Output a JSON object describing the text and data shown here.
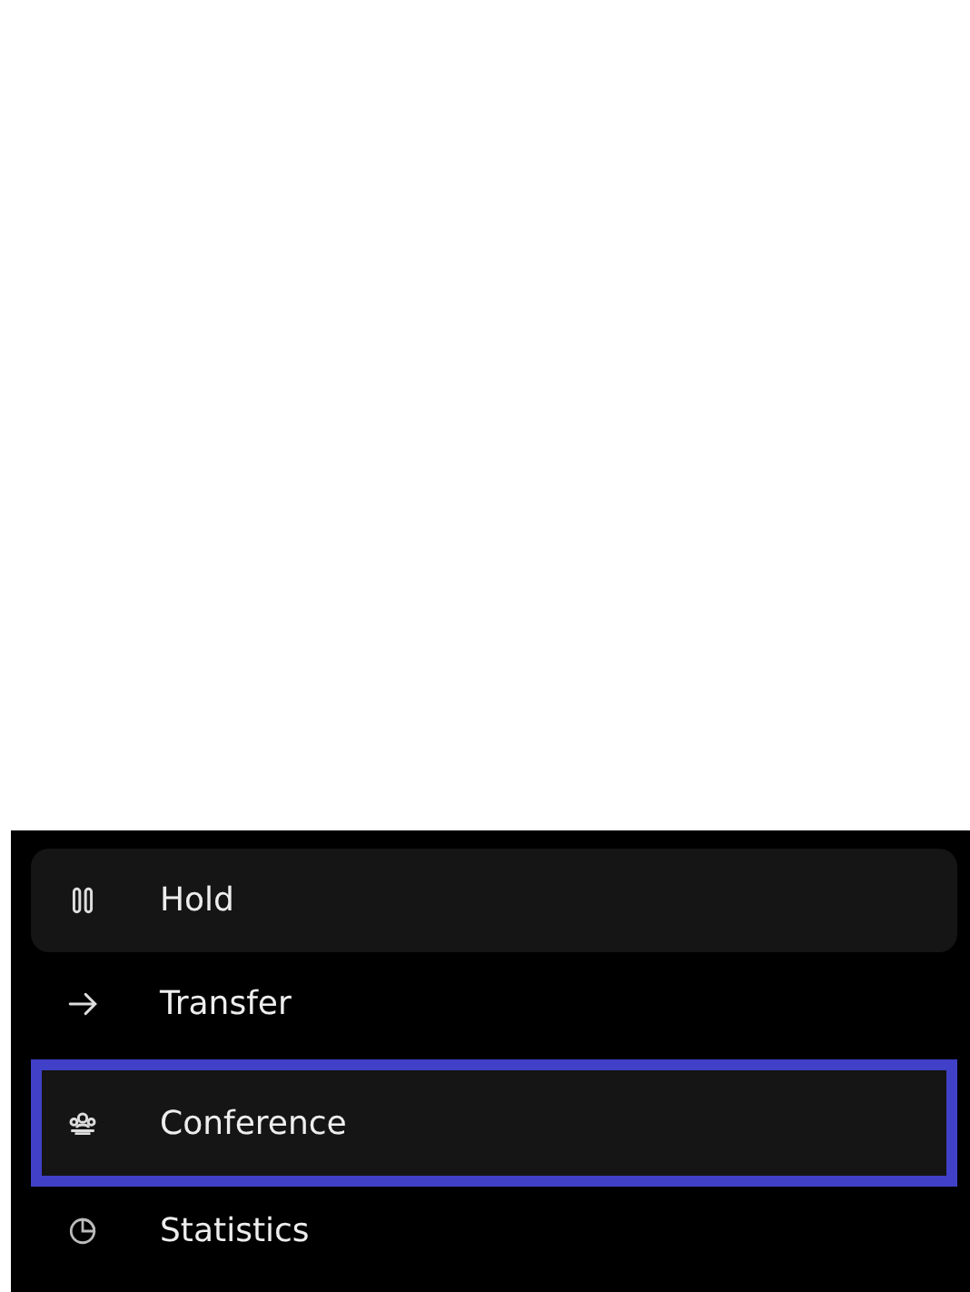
{
  "menu": {
    "items": [
      {
        "label": "Hold",
        "highlighted": true,
        "focused": false
      },
      {
        "label": "Transfer",
        "highlighted": false,
        "focused": false
      },
      {
        "label": "Conference",
        "highlighted": true,
        "focused": true
      },
      {
        "label": "Statistics",
        "highlighted": false,
        "focused": false
      }
    ]
  }
}
